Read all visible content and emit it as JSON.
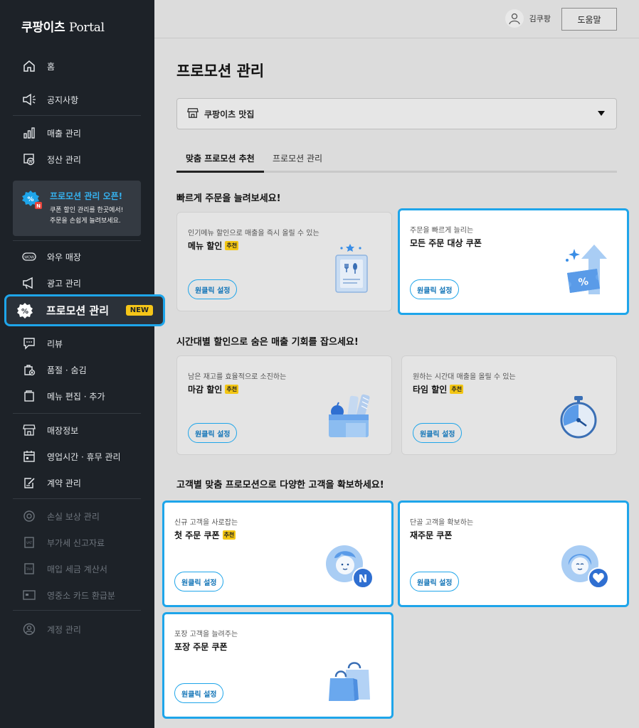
{
  "sidebar": {
    "brand": "쿠팡이츠",
    "brand_sub": "Portal",
    "items": [
      {
        "label": "홈",
        "icon": "home-icon"
      },
      {
        "label": "공지사항",
        "icon": "megaphone-icon"
      },
      {
        "label": "매출 관리",
        "icon": "bar-chart-icon"
      },
      {
        "label": "정산 관리",
        "icon": "settlement-icon"
      },
      {
        "label": "와우 매장",
        "icon": "wow-icon"
      },
      {
        "label": "광고 관리",
        "icon": "ad-megaphone-icon"
      },
      {
        "label": "프로모션 관리",
        "icon": "percent-icon"
      },
      {
        "label": "리뷰",
        "icon": "review-icon"
      },
      {
        "label": "품절 · 숨김",
        "icon": "soldout-icon"
      },
      {
        "label": "메뉴 편집 · 추가",
        "icon": "menu-edit-icon"
      },
      {
        "label": "매장정보",
        "icon": "store-icon"
      },
      {
        "label": "영업시간 · 휴무 관리",
        "icon": "calendar-icon"
      },
      {
        "label": "계약 관리",
        "icon": "contract-icon"
      },
      {
        "label": "손실 보상 관리",
        "icon": "compensation-icon"
      },
      {
        "label": "부가세 신고자료",
        "icon": "vat-icon"
      },
      {
        "label": "매입 세금 계산서",
        "icon": "tax-invoice-icon"
      },
      {
        "label": "영중소 카드 환급분",
        "icon": "card-icon"
      },
      {
        "label": "계정 관리",
        "icon": "account-icon"
      }
    ],
    "promo_box": {
      "title": "프로모션 관리 오픈!",
      "line1": "쿠폰 할인 관리를 한곳에서!",
      "line2": "주문을 손쉽게 늘려보세요."
    },
    "new_badge": "NEW",
    "colors": {
      "accent": "#1ea5ea",
      "background": "#1d2228",
      "badge": "#f5c518"
    }
  },
  "topbar": {
    "user_name": "김쿠팡",
    "help_label": "도움말"
  },
  "main": {
    "page_title": "프로모션 관리",
    "store_name": "쿠팡이츠 맛집",
    "tabs": [
      "맞춤 프로모션 추천",
      "프로모션 관리"
    ],
    "sections": [
      {
        "title": "빠르게 주문을 늘려보세요!"
      },
      {
        "title": "시간대별 할인으로 숨은 매출 기회를 잡으세요!"
      },
      {
        "title": "고객별 맞춤 프로모션으로 다양한 고객을 확보하세요!"
      }
    ],
    "cards": [
      {
        "subtitle": "인기메뉴 할인으로 매출을 즉시 올릴 수 있는",
        "title": "메뉴 할인",
        "tag": "추천",
        "button": "원클릭 설정"
      },
      {
        "subtitle": "주문을 빠르게 늘리는",
        "title": "모든 주문 대상 쿠폰",
        "button": "원클릭 설정"
      },
      {
        "subtitle": "남은 재고를 효율적으로 소진하는",
        "title": "마감 할인",
        "tag": "추천",
        "button": "원클릭 설정"
      },
      {
        "subtitle": "원하는 시간대 매출을 올릴 수 있는",
        "title": "타임 할인",
        "tag": "추천",
        "button": "원클릭 설정"
      },
      {
        "subtitle": "신규 고객을 사로잡는",
        "title": "첫 주문 쿠폰",
        "tag": "추천",
        "button": "원클릭 설정"
      },
      {
        "subtitle": "단골 고객을 확보하는",
        "title": "재주문 쿠폰",
        "button": "원클릭 설정"
      },
      {
        "subtitle": "포장 고객을 늘려주는",
        "title": "포장 주문 쿠폰",
        "button": "원클릭 설정"
      }
    ]
  }
}
